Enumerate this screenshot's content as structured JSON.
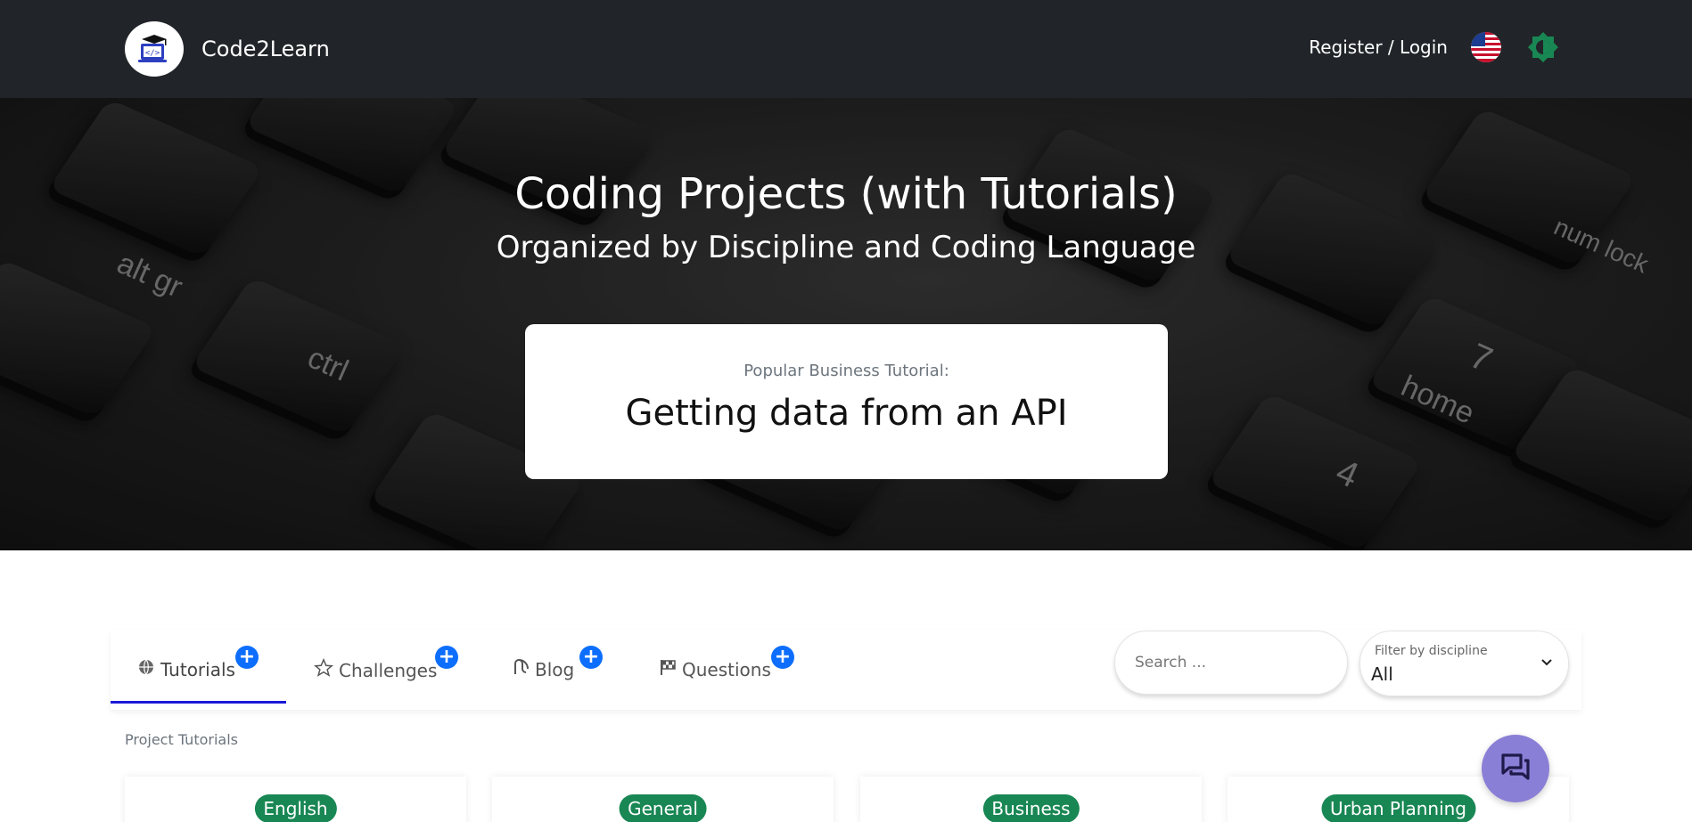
{
  "nav": {
    "brand": "Code2Learn",
    "login_link": "Register / Login",
    "language_icon": "us-flag-icon",
    "theme_icon": "theme-toggle-icon"
  },
  "hero": {
    "title": "Coding Projects (with Tutorials)",
    "subtitle": "Organized by Discipline and Coding Language",
    "popular_label": "Popular Business Tutorial:",
    "popular_title": "Getting data from an API",
    "key_labels": [
      "alt gr",
      "ctrl",
      "num lock",
      "home",
      "7",
      "4"
    ]
  },
  "tabs": [
    {
      "label": "Tutorials",
      "icon": "globe-icon",
      "active": true
    },
    {
      "label": "Challenges",
      "icon": "star-icon",
      "active": false
    },
    {
      "label": "Blog",
      "icon": "blog-icon",
      "active": false
    },
    {
      "label": "Questions",
      "icon": "flag-icon",
      "active": false
    }
  ],
  "search": {
    "placeholder": "Search ..."
  },
  "filter": {
    "label": "Filter by discipline",
    "value": "All"
  },
  "section_label": "Project Tutorials",
  "cards": [
    {
      "badge": "English"
    },
    {
      "badge": "General"
    },
    {
      "badge": "Business"
    },
    {
      "badge": "Urban Planning"
    }
  ],
  "colors": {
    "navbar": "#212529",
    "accent_blue": "#0d6efd",
    "badge_green": "#198754",
    "chat_fab": "#8a7fd6",
    "theme_icon": "#198754"
  }
}
